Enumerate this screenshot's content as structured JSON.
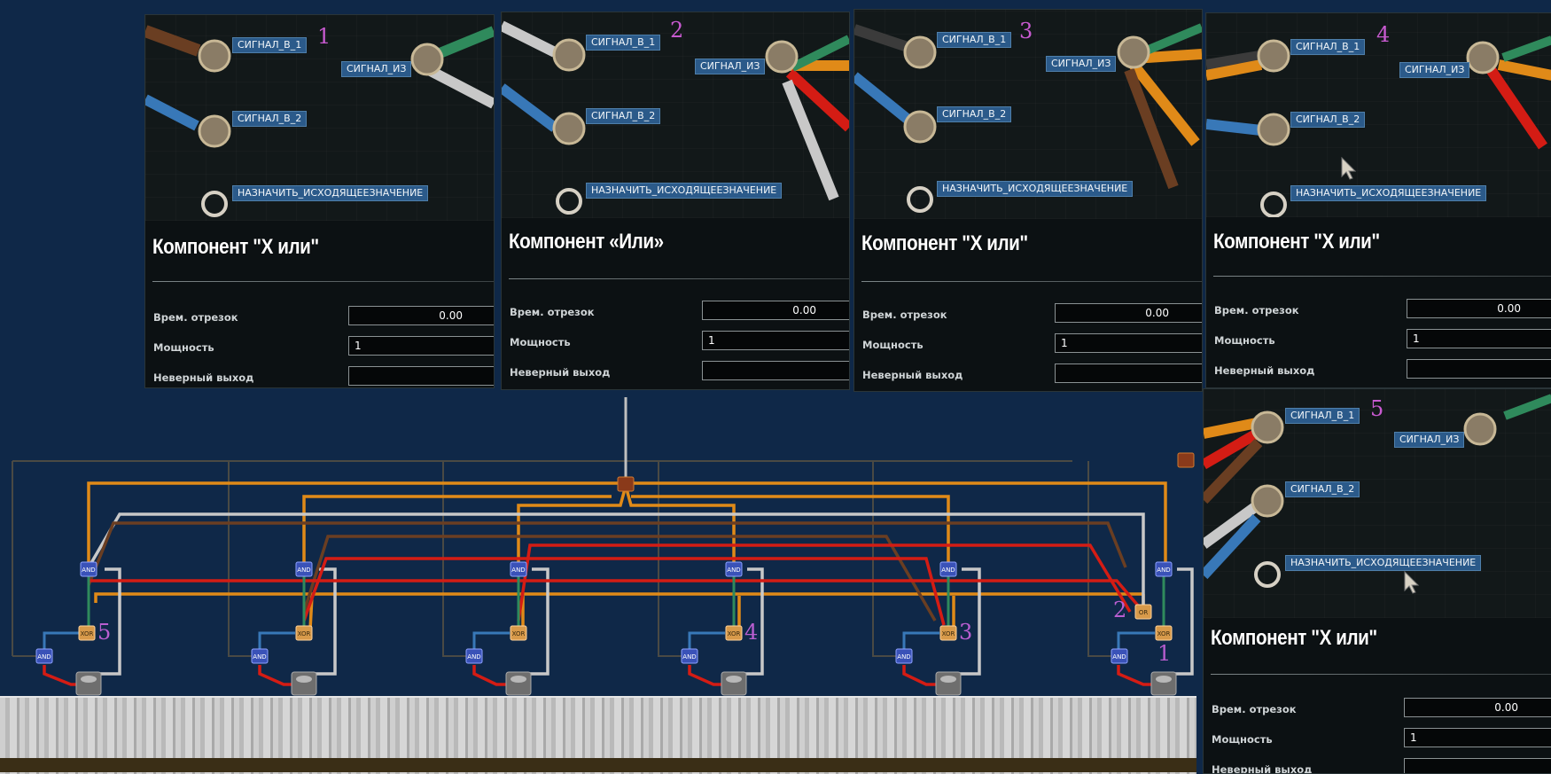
{
  "panels": [
    {
      "index": "1",
      "pins": {
        "in1": "СИГНАЛ_В_1",
        "in2": "СИГНАЛ_В_2",
        "out": "СИГНАЛ_ИЗ",
        "set": "НАЗНАЧИТЬ_ИСХОДЯЩЕЕЗНАЧЕНИЕ"
      },
      "title": "Компонент \"Х или\"",
      "rows": [
        {
          "label": "Врем. отрезок",
          "value": "0.00"
        },
        {
          "label": "Мощность",
          "value": "1"
        },
        {
          "label": "Неверный выход",
          "value": ""
        }
      ]
    },
    {
      "index": "2",
      "pins": {
        "in1": "СИГНАЛ_В_1",
        "in2": "СИГНАЛ_В_2",
        "out": "СИГНАЛ_ИЗ",
        "set": "НАЗНАЧИТЬ_ИСХОДЯЩЕЕЗНАЧЕНИЕ"
      },
      "title": "Компонент «Или»",
      "rows": [
        {
          "label": "Врем. отрезок",
          "value": "0.00"
        },
        {
          "label": "Мощность",
          "value": "1"
        },
        {
          "label": "Неверный выход",
          "value": ""
        }
      ]
    },
    {
      "index": "3",
      "pins": {
        "in1": "СИГНАЛ_В_1",
        "in2": "СИГНАЛ_В_2",
        "out": "СИГНАЛ_ИЗ",
        "set": "НАЗНАЧИТЬ_ИСХОДЯЩЕЕЗНАЧЕНИЕ"
      },
      "title": "Компонент \"Х или\"",
      "rows": [
        {
          "label": "Врем. отрезок",
          "value": "0.00"
        },
        {
          "label": "Мощность",
          "value": "1"
        },
        {
          "label": "Неверный выход",
          "value": ""
        }
      ]
    },
    {
      "index": "4",
      "pins": {
        "in1": "СИГНАЛ_В_1",
        "in2": "СИГНАЛ_В_2",
        "out": "СИГНАЛ_ИЗ",
        "set": "НАЗНАЧИТЬ_ИСХОДЯЩЕЕЗНАЧЕНИЕ"
      },
      "title": "Компонент \"Х или\"",
      "rows": [
        {
          "label": "Врем. отрезок",
          "value": "0.00"
        },
        {
          "label": "Мощность",
          "value": "1"
        },
        {
          "label": "Неверный выход",
          "value": ""
        }
      ]
    },
    {
      "index": "5",
      "pins": {
        "in1": "СИГНАЛ_В_1",
        "in2": "СИГНАЛ_В_2",
        "out": "СИГНАЛ_ИЗ",
        "set": "НАЗНАЧИТЬ_ИСХОДЯЩЕЕЗНАЧЕНИЕ"
      },
      "title": "Компонент \"Х или\"",
      "rows": [
        {
          "label": "Врем. отрезок",
          "value": "0.00"
        },
        {
          "label": "Мощность",
          "value": "1"
        },
        {
          "label": "Неверный выход",
          "value": ""
        }
      ]
    }
  ],
  "circuit": {
    "gate_labels": {
      "and": "AND",
      "xor": "XOR",
      "or": "OR"
    },
    "gate_numbers": [
      "5",
      "4",
      "3",
      "2",
      "1"
    ]
  },
  "colors": {
    "background": "#0f2848",
    "wire_orange": "#e08a18",
    "wire_red": "#d41c14",
    "wire_white": "#c8c8c8",
    "wire_brown": "#6a3e22",
    "wire_green": "#2f8a5c",
    "wire_blue": "#3878b8",
    "badge": "#c85ad0"
  }
}
